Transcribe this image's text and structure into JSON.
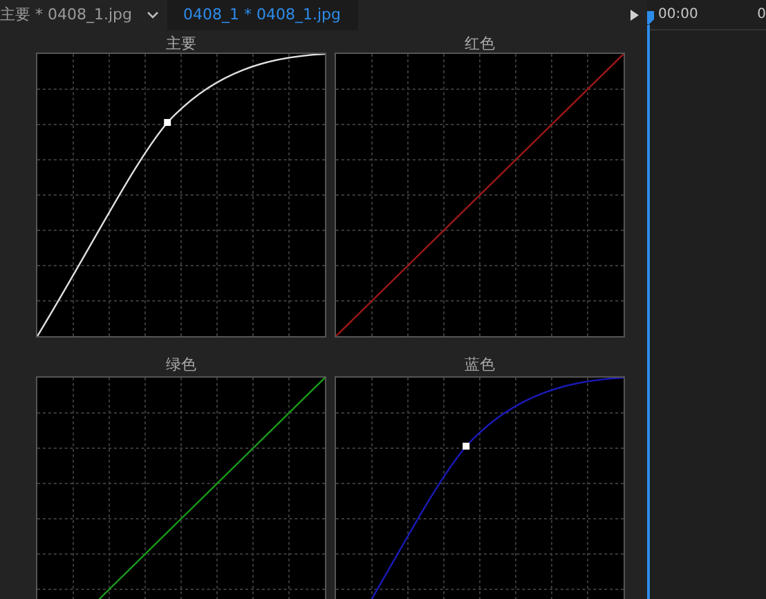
{
  "tabs": [
    {
      "label": "主要 * 0408_1.jpg",
      "selected": false
    },
    {
      "label": "0408_1 * 0408_1.jpg",
      "selected": true
    }
  ],
  "timeline": {
    "timecode": "00:00",
    "timecode_2": "0"
  },
  "curve_panels": [
    {
      "title": "主要",
      "kind": "bent",
      "color": "#e0e0e0"
    },
    {
      "title": "红色",
      "kind": "straight",
      "color": "#a01818"
    },
    {
      "title": "绿色",
      "kind": "straight",
      "color": "#1a9a1a"
    },
    {
      "title": "蓝色",
      "kind": "bent",
      "color": "#1a1ab8"
    }
  ]
}
